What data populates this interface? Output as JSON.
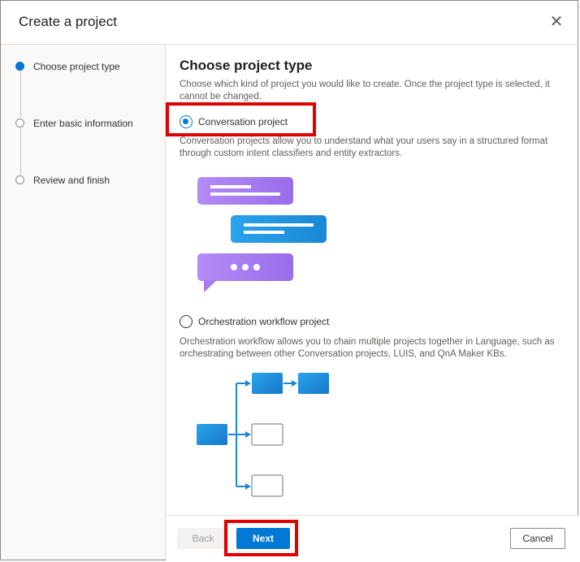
{
  "dialog": {
    "title": "Create a project",
    "close_icon": "close-icon"
  },
  "steps": [
    {
      "label": "Choose project type",
      "active": true
    },
    {
      "label": "Enter basic information",
      "active": false
    },
    {
      "label": "Review and finish",
      "active": false
    }
  ],
  "main": {
    "heading": "Choose project type",
    "description": "Choose which kind of project you would like to create. Once the project type is selected, it cannot be changed.",
    "options": [
      {
        "label": "Conversation project",
        "selected": true,
        "description": "Conversation projects allow you to understand what your users say in a structured format through custom intent classifiers and entity extractors.",
        "illustration": "chat-bubbles-illustration"
      },
      {
        "label": "Orchestration workflow project",
        "selected": false,
        "description": "Orchestration workflow allows you to chain multiple projects together in Language, such as orchestrating between other Conversation projects, LUIS, and QnA Maker KBs.",
        "illustration": "workflow-tree-illustration"
      }
    ]
  },
  "footer": {
    "back_label": "Back",
    "next_label": "Next",
    "cancel_label": "Cancel"
  },
  "colors": {
    "accent": "#0078d4",
    "highlight": "#e00000",
    "bubble_purple": "#a77cf0",
    "bubble_blue": "#1e90e0"
  }
}
